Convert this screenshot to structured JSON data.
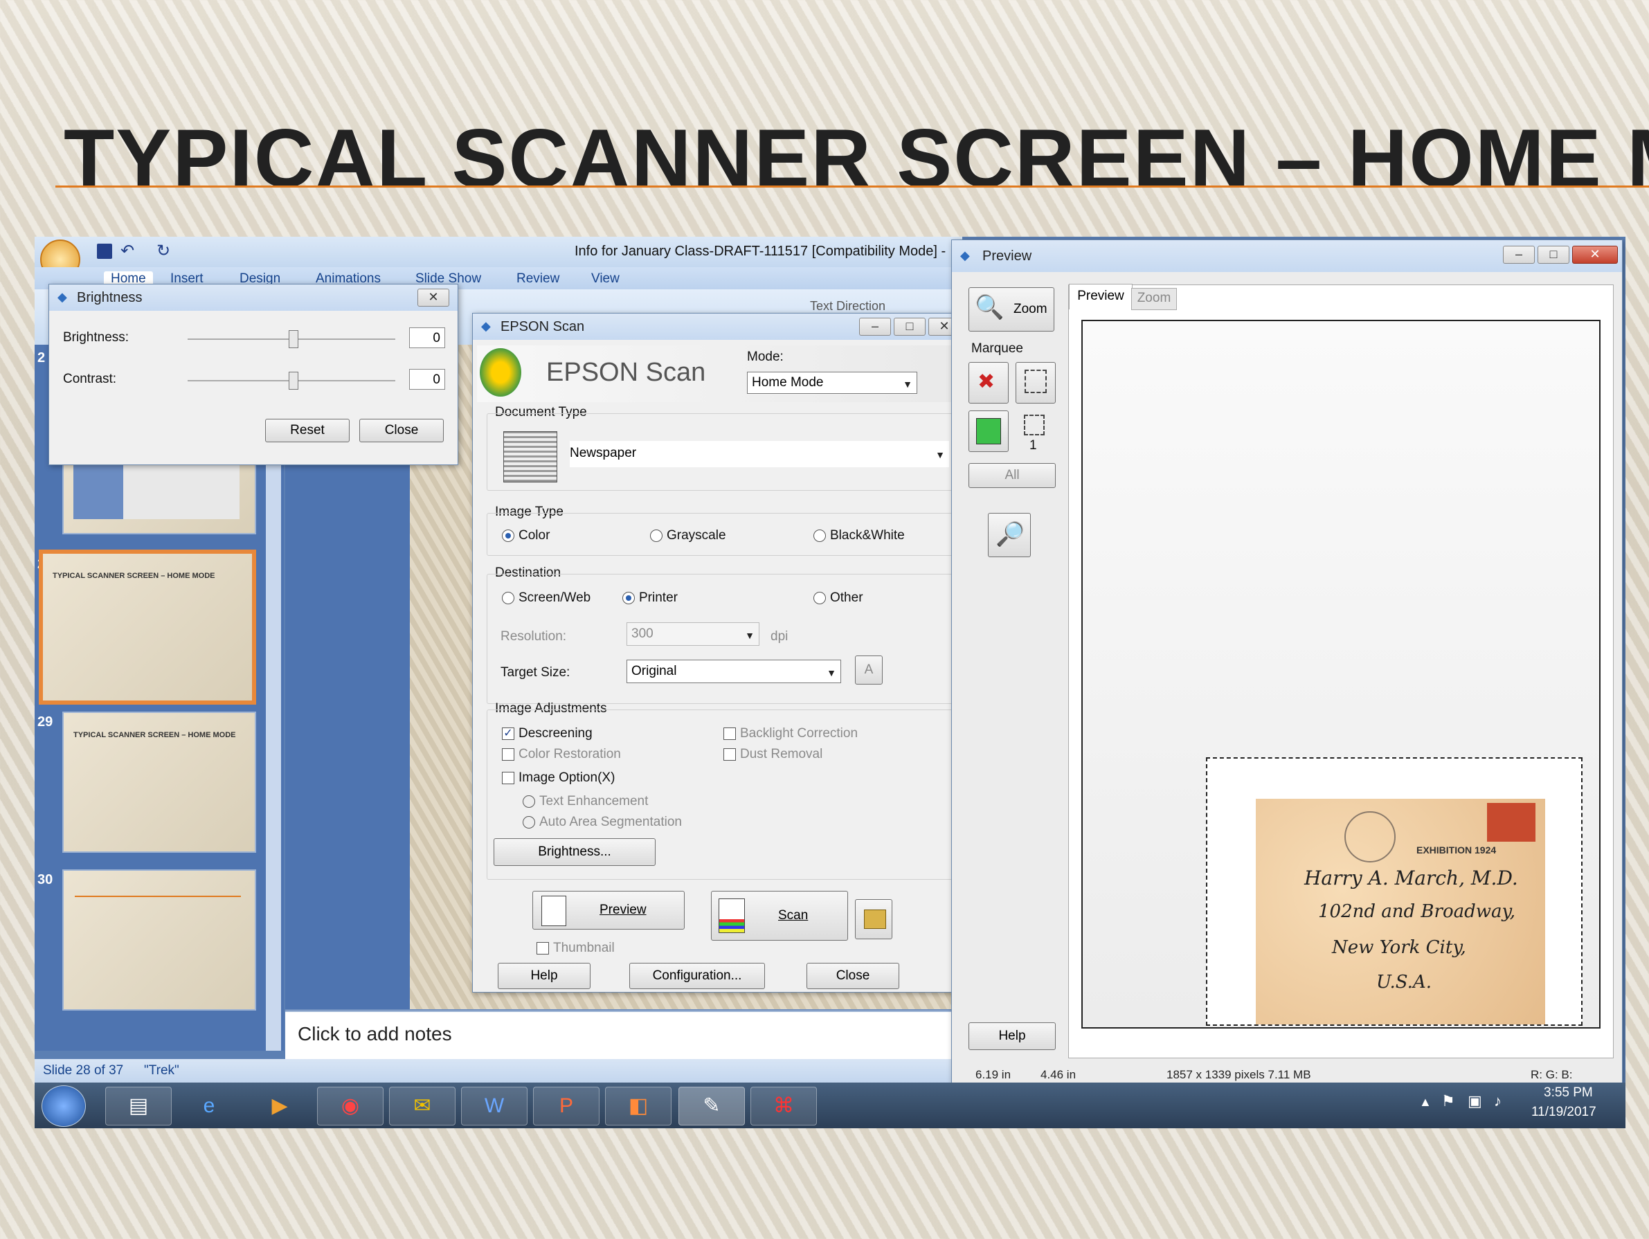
{
  "slide": {
    "title": "TYPICAL SCANNER SCREEN – HOME MODE"
  },
  "ppt": {
    "title": "Info for January Class-DRAFT-111517 [Compatibility Mode] -",
    "tabs": [
      "Home",
      "Insert",
      "Design",
      "Animations",
      "Slide Show",
      "Review",
      "View"
    ],
    "ribbon_partial": "Text Direction",
    "thumbs": [
      {
        "num": "2",
        "title": ""
      },
      {
        "num": "28",
        "title": "TYPICAL SCANNER SCREEN – HOME MODE"
      },
      {
        "num": "29",
        "title": "TYPICAL SCANNER SCREEN – HOME MODE"
      },
      {
        "num": "30",
        "title": ""
      }
    ],
    "notes_placeholder": "Click to add notes",
    "status": {
      "slide": "Slide 28 of 37",
      "theme": "\"Trek\""
    }
  },
  "brightness_dialog": {
    "title": "Brightness",
    "brightness_label": "Brightness:",
    "brightness_value": "0",
    "contrast_label": "Contrast:",
    "contrast_value": "0",
    "reset": "Reset",
    "close": "Close"
  },
  "epson": {
    "title": "EPSON Scan",
    "logo": "EPSON Scan",
    "mode_label": "Mode:",
    "mode_value": "Home Mode",
    "doc_type_label": "Document Type",
    "doc_type_value": "Newspaper",
    "image_type_label": "Image Type",
    "image_types": [
      "Color",
      "Grayscale",
      "Black&White"
    ],
    "image_type_selected": "Color",
    "destination_label": "Destination",
    "destinations": [
      "Screen/Web",
      "Printer",
      "Other"
    ],
    "destination_selected": "Printer",
    "resolution_label": "Resolution:",
    "resolution_value": "300",
    "resolution_unit": "dpi",
    "target_size_label": "Target Size:",
    "target_size_value": "Original",
    "target_size_btn": "A",
    "adjust_label": "Image Adjustments",
    "descreening": "Descreening",
    "backlight": "Backlight Correction",
    "color_restoration": "Color Restoration",
    "dust_removal": "Dust Removal",
    "image_option": "Image Option(X)",
    "text_enhancement": "Text Enhancement",
    "auto_area": "Auto Area Segmentation",
    "brightness_btn": "Brightness...",
    "preview_btn": "Preview",
    "scan_btn": "Scan",
    "thumbnail": "Thumbnail",
    "help": "Help",
    "configuration": "Configuration...",
    "close": "Close"
  },
  "preview": {
    "title": "Preview",
    "zoom_btn": "Zoom",
    "marquee_label": "Marquee",
    "marquee_count": "1",
    "all_btn": "All",
    "tabs": [
      "Preview",
      "Zoom"
    ],
    "help": "Help",
    "status_w": "6.19 in",
    "status_h": "4.46 in",
    "status_pixels": "1857 x 1339 pixels 7.11 MB",
    "status_rgb": "R: G: B:",
    "envelope_lines": [
      "Harry A. March, M.D.",
      "102nd and Broadway,",
      "New York City,",
      "U.S.A."
    ],
    "stamp_text": "EXHIBITION 1924"
  },
  "taskbar": {
    "time": "3:55 PM",
    "date": "11/19/2017"
  },
  "colors": {
    "accent": "#e07a1f",
    "ppt_blue": "#4e74b0",
    "title_text": "#222222"
  }
}
